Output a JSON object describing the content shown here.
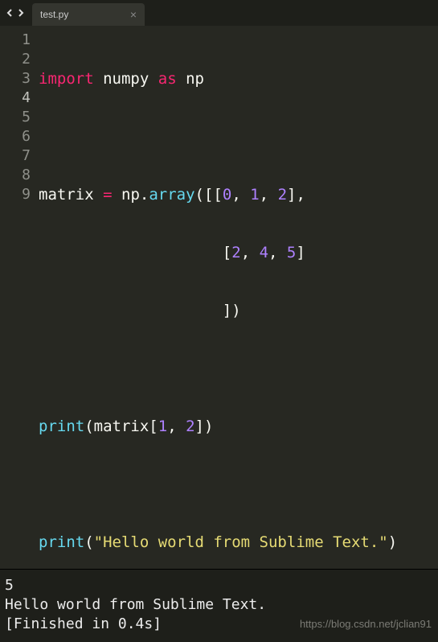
{
  "tab": {
    "filename": "test.py",
    "close_glyph": "×"
  },
  "line_numbers": [
    "1",
    "2",
    "3",
    "4",
    "5",
    "6",
    "7",
    "8",
    "9"
  ],
  "current_line": 4,
  "code": {
    "l1": {
      "import": "import",
      "numpy": "numpy",
      "as": "as",
      "np": "np"
    },
    "l3": {
      "matrix": "matrix",
      "eq": "=",
      "np": "np",
      "dot": ".",
      "array": "array",
      "open": "([[",
      "n0": "0",
      "c1": ", ",
      "n1": "1",
      "c2": ", ",
      "n2": "2",
      "close": "],"
    },
    "l4": {
      "pad": "                    ",
      "open": "[",
      "n0": "2",
      "c1": ", ",
      "n1": "4",
      "c2": ", ",
      "n2": "5",
      "close": "]"
    },
    "l5": {
      "pad": "                    ",
      "close": "])"
    },
    "l7": {
      "print": "print",
      "open": "(",
      "matrix": "matrix",
      "br1": "[",
      "n0": "1",
      "c1": ", ",
      "n1": "2",
      "br2": "]",
      "close": ")"
    },
    "l9": {
      "print": "print",
      "open": "(",
      "str": "\"Hello world from Sublime Text.\"",
      "close": ")"
    }
  },
  "console": {
    "line1": "5",
    "line2": "Hello world from Sublime Text.",
    "line3": "[Finished in 0.4s]"
  },
  "watermark": "https://blog.csdn.net/jclian91"
}
